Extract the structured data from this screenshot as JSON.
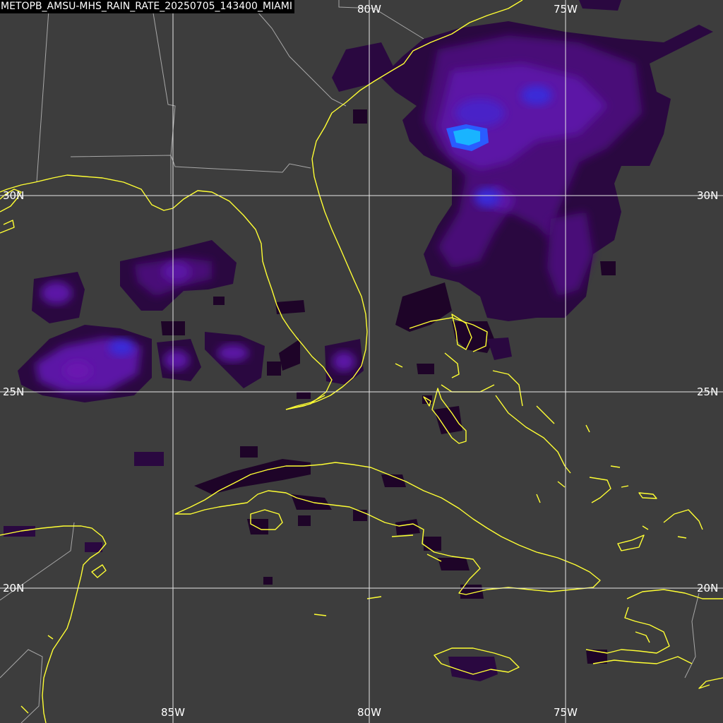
{
  "title": "METOPB_AMSU-MHS_RAIN_RATE_20250705_143400_MIAMI",
  "grid": {
    "lon_labels_top": [
      "80W",
      "75W"
    ],
    "lon_labels_bottom": [
      "85W",
      "80W",
      "75W"
    ],
    "lat_labels_left": [
      "30N",
      "25N",
      "20N"
    ],
    "lat_labels_right": [
      "30N",
      "25N",
      "20N"
    ]
  },
  "colors": {
    "background": "#3d3d3d",
    "gridline": "#e6e6e6",
    "coastline": "#ffff33",
    "borders": "#a8a8a8",
    "rain_light": "#1e0428",
    "rain_moderate": "#5a0a8c",
    "rain_heavy": "#2a2aff",
    "rain_max": "#19b4ff"
  },
  "legend_items": []
}
